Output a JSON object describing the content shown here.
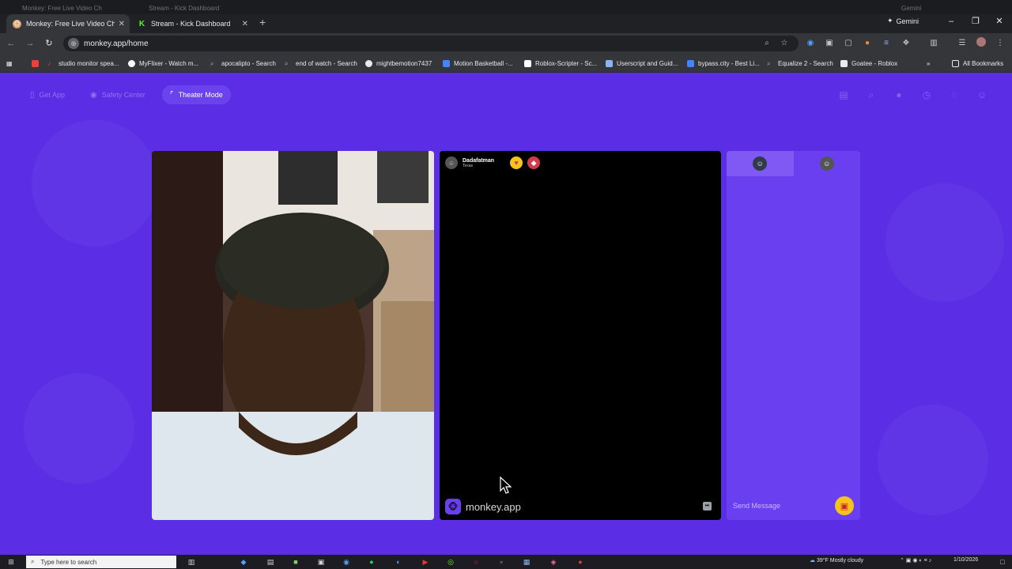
{
  "browser": {
    "tabs": [
      {
        "title": "Monkey: Free Live Video Ch",
        "favicon": "monkey-icon",
        "active": true
      },
      {
        "title": "Stream - Kick Dashboard",
        "favicon": "kick-icon",
        "active": false
      }
    ],
    "ghost_tabs": [
      {
        "title": "Monkey: Free Live Video Ch"
      },
      {
        "title": "Stream - Kick Dashboard"
      }
    ],
    "new_tab_label": "+",
    "gemini_label": "Gemini",
    "ghost_gemini_label": "Gemini",
    "url": "monkey.app/home",
    "all_bookmarks_label": "All Bookmarks",
    "bookmarks": [
      {
        "label": "studio monitor spea...",
        "color": "#ea4335"
      },
      {
        "label": "MyFlixer - Watch m...",
        "color": "#ffffff"
      },
      {
        "label": "apocalipto - Search",
        "color": "#8ab4f8"
      },
      {
        "label": "end of watch - Search",
        "color": "#8ab4f8"
      },
      {
        "label": "mightbemotion7437",
        "color": "#e8eaed"
      },
      {
        "label": "Motion Basketball -...",
        "color": "#4285f4"
      },
      {
        "label": "Roblox-Scripter - Sc...",
        "color": "#ffffff"
      },
      {
        "label": "Userscript and Guid...",
        "color": "#8ab4f8"
      },
      {
        "label": "bypass.city - Best Li...",
        "color": "#4285f4"
      },
      {
        "label": "Equalize 2 - Search",
        "color": "#8ab4f8"
      },
      {
        "label": "Goatee - Roblox",
        "color": "#e8eaed"
      }
    ]
  },
  "app": {
    "top_buttons": {
      "get_app": "Get App",
      "safety_center": "Safety Center",
      "theater_mode": "Theater Mode"
    },
    "remote_user": {
      "name": "Dadafatman",
      "location": "Texas"
    },
    "brand_name": "monkey.app",
    "chat": {
      "send_placeholder": "Send Message"
    }
  },
  "taskbar": {
    "search_placeholder": "Type here to search",
    "weather": "39°F  Mostly cloudy",
    "date": "1/10/2026"
  },
  "colors": {
    "page_bg": "#5b2ee6",
    "accent": "#6a3ff0",
    "gift": "#f6c21b"
  }
}
